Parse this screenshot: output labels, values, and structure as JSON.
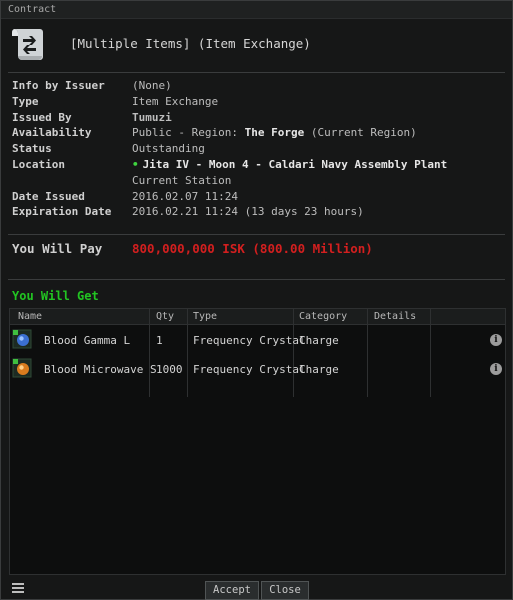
{
  "window": {
    "title": "Contract"
  },
  "header": {
    "contract_title": "[Multiple Items] (Item Exchange)",
    "icon": "contract-scroll-icon"
  },
  "info": {
    "info_by_issuer": {
      "label": "Info by Issuer",
      "value": "(None)"
    },
    "type": {
      "label": "Type",
      "value": "Item Exchange"
    },
    "issued_by": {
      "label": "Issued By",
      "value": "Tumuzi"
    },
    "availability": {
      "label": "Availability",
      "prefix": "Public - Region:",
      "region": "The Forge",
      "suffix": "(Current Region)"
    },
    "status": {
      "label": "Status",
      "value": "Outstanding"
    },
    "location": {
      "label": "Location",
      "value": "Jita IV - Moon 4 - Caldari Navy Assembly Plant",
      "sub": "Current Station"
    },
    "date_issued": {
      "label": "Date Issued",
      "value": "2016.02.07 11:24"
    },
    "expiration_date": {
      "label": "Expiration Date",
      "value": "2016.02.21 11:24 (13 days 23 hours)"
    }
  },
  "pay": {
    "label": "You Will Pay",
    "value": "800,000,000 ISK (800.00 Million)",
    "color": "#d31f1f"
  },
  "get": {
    "label": "You Will Get",
    "color": "#22c422",
    "columns": [
      "Name",
      "Qty",
      "Type",
      "Category",
      "Details"
    ],
    "rows": [
      {
        "name": "Blood Gamma L",
        "qty": "1",
        "type": "Frequency Crystal",
        "category": "Charge",
        "details": "",
        "icon": "gamma-crystal-icon"
      },
      {
        "name": "Blood Microwave S",
        "qty": "1000",
        "type": "Frequency Crystal",
        "category": "Charge",
        "details": "",
        "icon": "microwave-crystal-icon"
      }
    ]
  },
  "buttons": {
    "accept": "Accept",
    "close": "Close"
  }
}
